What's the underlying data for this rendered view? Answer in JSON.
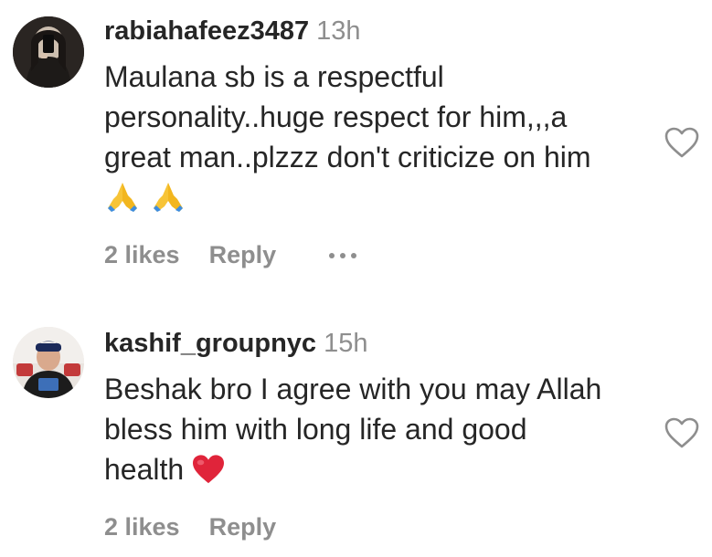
{
  "comments": [
    {
      "username": "rabiahafeez3487",
      "time": "13h",
      "text_lines": [
        "Maulana sb is a respectful",
        "personality..huge respect for him,,,a",
        "great man..plzzz don't criticize on him"
      ],
      "emoji_row": [
        "🙏",
        "🙏"
      ],
      "emoji_row_icons": [
        "folded-hands-icon",
        "folded-hands-icon"
      ],
      "likes": "2 likes",
      "reply": "Reply",
      "has_more_menu": true
    },
    {
      "username": "kashif_groupnyc",
      "time": "15h",
      "text_lines": [
        "Beshak bro I agree with you may Allah",
        "bless him with long life and good",
        "health"
      ],
      "inline_emoji": "❤️",
      "inline_emoji_icon": "red-heart-icon",
      "likes": "2 likes",
      "reply": "Reply",
      "has_more_menu": false
    }
  ],
  "colors": {
    "text": "#262626",
    "secondary": "#8e8e8e",
    "heart_red": "#e0243a",
    "background": "#ffffff"
  },
  "icons": {
    "like": "heart-outline-icon",
    "more": "ellipsis-icon"
  }
}
